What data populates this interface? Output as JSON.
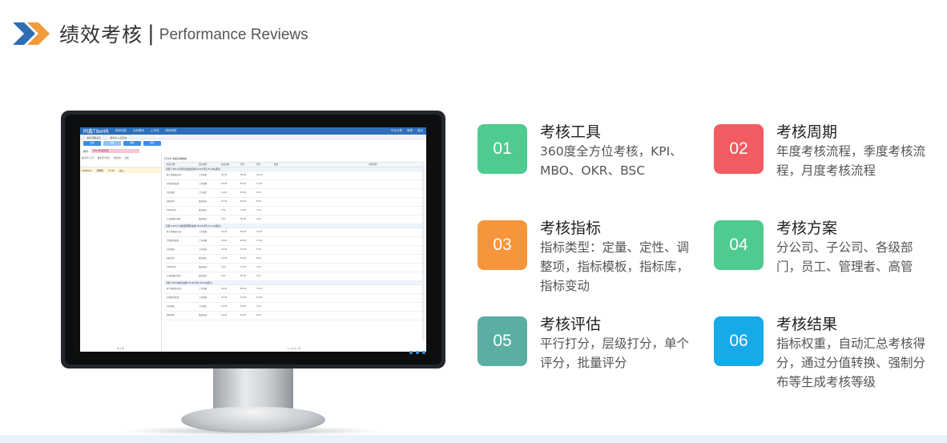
{
  "header": {
    "title": "绩效考核",
    "separator": "|",
    "subtitle": "Performance Reviews"
  },
  "screen": {
    "app_name": "同鑫T9eHR",
    "menu": [
      "常用功能",
      "业务模块",
      "工作流",
      "绩效考核"
    ],
    "top_right": [
      "华北分部",
      "管理",
      "退出"
    ],
    "tabs": [
      "考核流程设定",
      "部考评人员查询"
    ],
    "tool_buttons": [
      "新建",
      "修改",
      "删除",
      "刷新"
    ],
    "period_label": "期间:",
    "period_value": "2019年度考核",
    "left_headers": [
      "被考评人工号",
      "被考评人姓名",
      "考核总分",
      "层级"
    ],
    "left_row": [
      "0000621",
      "刘明辉",
      "75.26",
      "总公"
    ],
    "left_footer": "第 1 页",
    "right_title": "打分方 考核表单模板",
    "right_headers": [
      "指标名称",
      "指标类型",
      "指标权重",
      "评分",
      "得分",
      "描述",
      "考核说明"
    ],
    "groups": [
      "考核人:001公司领导(总监)[权重:20.00 评分:75.00](满分)",
      "考核人:002人力资源部经理[权重:30.00 评分:67.30](满分)",
      "考核人:003(本部)[权重:50.00 评分:60.00](满分)"
    ],
    "rows": [
      [
        "客户满意度/投诉",
        "工作质量",
        "40.00",
        "80.00",
        "32.00"
      ],
      [
        "行政事务处理",
        "工作质量",
        "20.00",
        "60.00",
        "12.00"
      ],
      [
        "内控制度",
        "工作态度",
        "10.00",
        "50.00",
        "5.00"
      ],
      [
        "团队协作",
        "绩效指标",
        "10.00",
        "60.00",
        "6.00"
      ],
      [
        "5S/6S执行",
        "绩效指标",
        "5.00",
        "70.00",
        "3.50"
      ],
      [
        "产品质量合格率",
        "绩效指标",
        "5.00",
        "80.00",
        "4.00"
      ]
    ],
    "right_footer": "1 / 16  共 1 条"
  },
  "features": [
    {
      "num": "01",
      "title": "考核工具",
      "desc": "360度全方位考核，KPI、MBO、OKR、BSC",
      "color": "#4ecb8f"
    },
    {
      "num": "02",
      "title": "考核周期",
      "desc": "年度考核流程，季度考核流程，月度考核流程",
      "color": "#f25b61"
    },
    {
      "num": "03",
      "title": "考核指标",
      "desc": "指标类型：定量、定性、调整项，指标模板，指标库，指标变动",
      "color": "#f7953c"
    },
    {
      "num": "04",
      "title": "考核方案",
      "desc": "分公司、子公司、各级部门，员工、管理者、高管",
      "color": "#4ecb8f"
    },
    {
      "num": "05",
      "title": "考核评估",
      "desc": "平行打分，层级打分，单个评分，批量评分",
      "color": "#5aaea2"
    },
    {
      "num": "06",
      "title": "考核结果",
      "desc": "指标权重，自动汇总考核得分，通过分值转换、强制分布等生成考核等级",
      "color": "#16aae8"
    }
  ]
}
